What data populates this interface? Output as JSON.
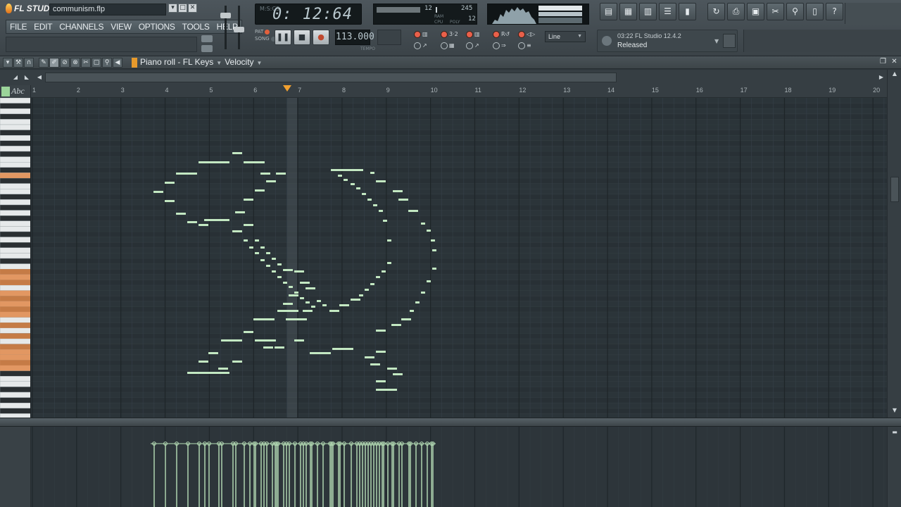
{
  "app": {
    "project_name": "communism.flp",
    "menu": [
      "FILE",
      "EDIT",
      "CHANNELS",
      "VIEW",
      "OPTIONS",
      "TOOLS",
      "HELP"
    ]
  },
  "transport": {
    "time": "0: 12:64",
    "time_mode": "M:S:CS",
    "pat_label": "PAT",
    "song_label": "SONG",
    "tempo": "113.000",
    "tempo_label": "TEMPO",
    "pause_symbol": "❚❚",
    "stop_symbol": "■",
    "record_symbol": "●"
  },
  "cpu": {
    "value1": "12",
    "value2": "245",
    "value3": "12",
    "cpu_label": "CPU",
    "poly_label": "POLY",
    "ram_label": "RAM"
  },
  "snap_mode": "Line",
  "news": {
    "line1": "03:22  FL Studio 12.4.2",
    "line2": "Released"
  },
  "piano_roll": {
    "title": "Piano roll - FL Keys",
    "target": "Velocity",
    "ruler_labels": [
      "1",
      "2",
      "3",
      "4",
      "5",
      "6",
      "7",
      "8",
      "9",
      "10",
      "11",
      "12",
      "13",
      "14",
      "15",
      "16",
      "17",
      "18",
      "19",
      "20"
    ],
    "abc_label": "Abc"
  },
  "colors": {
    "note_fill": "#c3e8c2",
    "grid_bg": "#2b3439",
    "accent": "#f0a030"
  },
  "icons": [
    "fl-flame-logo",
    "minimize-icon",
    "maximize-icon",
    "close-icon",
    "pause-icon",
    "stop-icon",
    "record-icon",
    "playlist-icon",
    "step-sequencer-icon",
    "piano-roll-icon",
    "mixer-icon",
    "channel-rack-icon",
    "undo-icon",
    "save-icon",
    "render-icon",
    "cut-icon",
    "browser-icon",
    "plugin-picker-icon",
    "help-icon",
    "pencil-icon",
    "brush-icon",
    "magnet-icon",
    "scissors-icon",
    "zoom-icon",
    "speaker-icon"
  ]
}
